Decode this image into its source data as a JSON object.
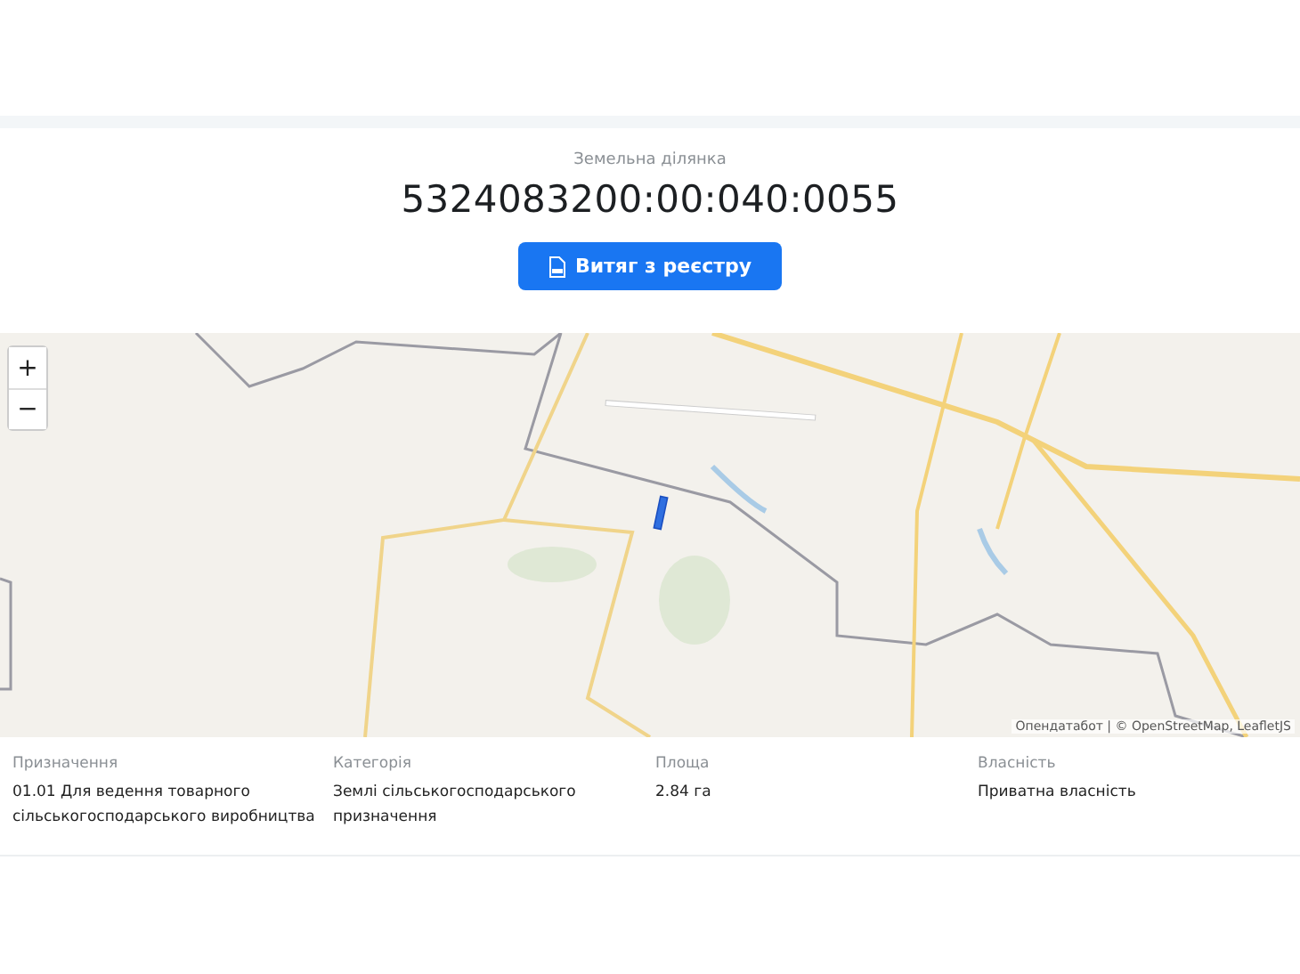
{
  "header": {
    "label": "Земельна ділянка",
    "cadastral_number": "5324083200:00:040:0055",
    "button": "Витяг з реєстру"
  },
  "map": {
    "zoom_in": "+",
    "zoom_out": "−",
    "attribution": "Опендатабот | © OpenStreetMap, LeafletJS"
  },
  "details": [
    {
      "label": "Призначення",
      "value": "01.01 Для ведення товарного сільськогосподарського виробництва"
    },
    {
      "label": "Категорія",
      "value": "Землі сільськогосподарського призначення"
    },
    {
      "label": "Площа",
      "value": "2.84 га"
    },
    {
      "label": "Власність",
      "value": "Приватна власність"
    }
  ]
}
